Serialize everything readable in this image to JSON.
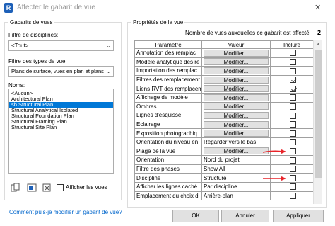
{
  "window": {
    "title": "Affecter le gabarit de vue",
    "icon_letter": "R",
    "close_glyph": "✕"
  },
  "left": {
    "group_title": "Gabarits de vues",
    "discipline_filter": {
      "label": "Filtre de disciplines:",
      "value": "<Tout>"
    },
    "type_filter": {
      "label": "Filtre des types de vue:",
      "value": "Plans de surface, vues en plan et plans"
    },
    "names": {
      "label": "Noms:",
      "items": [
        {
          "text": "<Aucun>",
          "selected": false
        },
        {
          "text": "Architectural Plan",
          "selected": false
        },
        {
          "text": "sb.Structural Plan",
          "selected": true
        },
        {
          "text": "Structural Analytical Isolated",
          "selected": false
        },
        {
          "text": "Structural Foundation Plan",
          "selected": false
        },
        {
          "text": "Structural Framing Plan",
          "selected": false
        },
        {
          "text": "Structural Site Plan",
          "selected": false
        }
      ]
    },
    "show_views_label": "Afficher les vues"
  },
  "right": {
    "group_title": "Propriétés de la vue",
    "count_label": "Nombre de vues auxquelles ce gabarit est affecté:",
    "count_value": "2",
    "columns": {
      "param": "Paramètre",
      "value": "Valeur",
      "include": "Inclure"
    },
    "rows": [
      {
        "param": "Annotation des remplac",
        "value": "Modifier...",
        "button": true,
        "checked": false
      },
      {
        "param": "Modèle analytique des re",
        "value": "Modifier...",
        "button": true,
        "checked": false
      },
      {
        "param": "Importation des remplac",
        "value": "Modifier...",
        "button": true,
        "checked": false
      },
      {
        "param": "Filtres des remplacement",
        "value": "Modifier...",
        "button": true,
        "checked": true
      },
      {
        "param": "Liens RVT des remplacem",
        "value": "Modifier...",
        "button": true,
        "checked": true
      },
      {
        "param": "Affichage de modèle",
        "value": "Modifier...",
        "button": true,
        "checked": false
      },
      {
        "param": "Ombres",
        "value": "Modifier...",
        "button": true,
        "checked": false
      },
      {
        "param": "Lignes d'esquisse",
        "value": "Modifier...",
        "button": true,
        "checked": false
      },
      {
        "param": "Eclairage",
        "value": "Modifier...",
        "button": true,
        "checked": false
      },
      {
        "param": "Exposition photographiq",
        "value": "Modifier...",
        "button": true,
        "checked": false
      },
      {
        "param": "Orientation du niveau en",
        "value": "Regarder vers le bas",
        "button": false,
        "checked": false
      },
      {
        "param": "Plage de la vue",
        "value": "Modifier...",
        "button": true,
        "checked": false
      },
      {
        "param": "Orientation",
        "value": "Nord du projet",
        "button": false,
        "checked": false
      },
      {
        "param": "Filtre des phases",
        "value": "Show All",
        "button": false,
        "checked": false
      },
      {
        "param": "Discipline",
        "value": "Structure",
        "button": false,
        "checked": false
      },
      {
        "param": "Afficher les lignes caché",
        "value": "Par discipline",
        "button": false,
        "checked": false
      },
      {
        "param": "Emplacement du choix d",
        "value": "Arrière-plan",
        "button": false,
        "checked": false
      }
    ]
  },
  "footer": {
    "help_link": "Comment puis-je modifier un gabarit de vue?",
    "ok": "OK",
    "cancel": "Annuler",
    "apply": "Appliquer"
  },
  "colors": {
    "selection": "#0078d7",
    "annotation_arrow": "#e8242a",
    "link": "#0066cc"
  }
}
